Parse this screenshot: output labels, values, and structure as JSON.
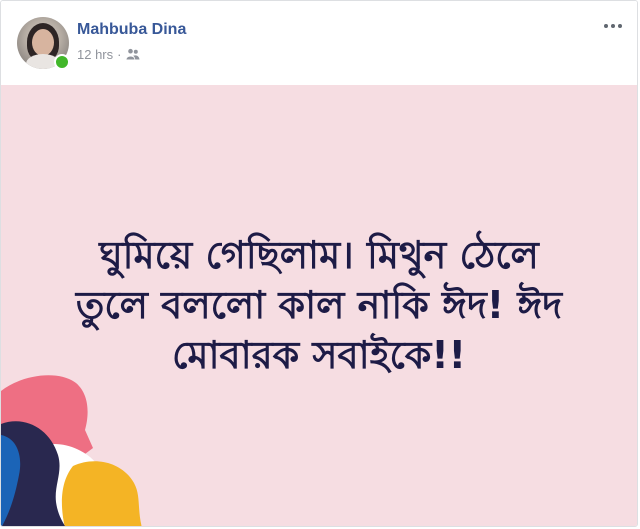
{
  "post": {
    "author": "Mahbuba Dina",
    "timestamp": "12 hrs",
    "separator": "·",
    "audience_icon": "friends-icon",
    "more_icon": "more-options-icon",
    "text_line1": "ঘুমিয়ে গেছিলাম। মিথুন ঠেলে",
    "text_line2": "তুলে বললো কাল নাকি ঈদ! ঈদ",
    "text_line3": "মোবারক সবাইকে!!"
  },
  "colors": {
    "author_name": "#385898",
    "meta_text": "#90949c",
    "online_indicator": "#42b72a",
    "post_background": "#f6dde2",
    "post_text": "#1d1b46"
  }
}
